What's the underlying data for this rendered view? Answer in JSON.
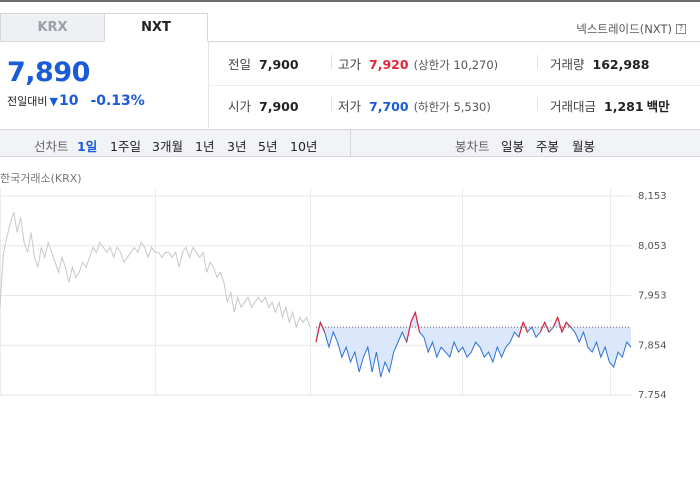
{
  "tabs": [
    {
      "label": "KRX",
      "active": false
    },
    {
      "label": "NXT",
      "active": true
    }
  ],
  "exchange_link": "넥스트레이드(NXT)",
  "summary": {
    "price": "7,890",
    "change_label": "전일대비",
    "change_value": "10",
    "change_pct": "-0.13%",
    "direction": "down"
  },
  "stats": {
    "prev_close": {
      "label": "전일",
      "value": "7,900"
    },
    "high": {
      "label": "고가",
      "value": "7,920",
      "sub": "(상한가 10,270)"
    },
    "volume": {
      "label": "거래량",
      "value": "162,988"
    },
    "open": {
      "label": "시가",
      "value": "7,900"
    },
    "low": {
      "label": "저가",
      "value": "7,700",
      "sub": "(하한가 5,530)"
    },
    "amount": {
      "label": "거래대금",
      "value": "1,281",
      "unit": "백만"
    }
  },
  "period_bar": {
    "line_label": "선차트",
    "periods": [
      "1일",
      "1주일",
      "3개월",
      "1년",
      "3년",
      "5년",
      "10년"
    ],
    "active_period": "1일",
    "candle_label": "봉차트",
    "candles": [
      "일봉",
      "주봉",
      "월봉"
    ]
  },
  "colors": {
    "up": "#e0263a",
    "down": "#1a5bd8",
    "krx_line": "#c8c8c8",
    "nxt_line": "#2f6fd6",
    "nxt_fill": "#dbe7fb"
  },
  "chart_data": {
    "type": "line",
    "title": "한국거래소(KRX)",
    "y_ticks": [
      "8,153",
      "8,053",
      "7,953",
      "7,854",
      "7,754"
    ],
    "ylim": [
      7754,
      8153
    ],
    "reference_price": 7890,
    "series": [
      {
        "name": "KRX",
        "values": [
          7930,
          8040,
          8070,
          8100,
          8120,
          8080,
          8110,
          8060,
          8040,
          8080,
          8030,
          8010,
          8050,
          8030,
          8060,
          8040,
          8020,
          8000,
          8030,
          8010,
          7980,
          8010,
          7990,
          8000,
          8020,
          8010,
          8030,
          8050,
          8040,
          8060,
          8050,
          8040,
          8050,
          8030,
          8050,
          8040,
          8020,
          8030,
          8040,
          8050,
          8040,
          8060,
          8050,
          8030,
          8050,
          8040,
          8040,
          8030,
          8040,
          8040,
          8030,
          8040,
          8010,
          8040,
          8050,
          8030,
          8050,
          8040,
          8030,
          8040,
          8000,
          8020,
          8010,
          7990,
          8000,
          7980,
          7940,
          7960,
          7920,
          7950,
          7930,
          7940,
          7950,
          7930,
          7940,
          7950,
          7940,
          7950,
          7930,
          7940,
          7920,
          7940,
          7910,
          7930,
          7900,
          7920,
          7890,
          7910,
          7900,
          7910,
          7890
        ]
      },
      {
        "name": "NXT",
        "values": [
          7860,
          7900,
          7880,
          7850,
          7880,
          7860,
          7830,
          7850,
          7820,
          7840,
          7800,
          7830,
          7850,
          7800,
          7840,
          7790,
          7820,
          7800,
          7840,
          7860,
          7880,
          7860,
          7900,
          7920,
          7880,
          7870,
          7840,
          7860,
          7830,
          7850,
          7840,
          7830,
          7860,
          7840,
          7850,
          7830,
          7840,
          7860,
          7850,
          7830,
          7840,
          7820,
          7850,
          7830,
          7850,
          7860,
          7880,
          7870,
          7900,
          7880,
          7890,
          7870,
          7880,
          7900,
          7880,
          7890,
          7910,
          7880,
          7900,
          7890,
          7880,
          7860,
          7880,
          7850,
          7840,
          7860,
          7830,
          7850,
          7820,
          7810,
          7840,
          7830,
          7860,
          7850
        ]
      }
    ]
  }
}
